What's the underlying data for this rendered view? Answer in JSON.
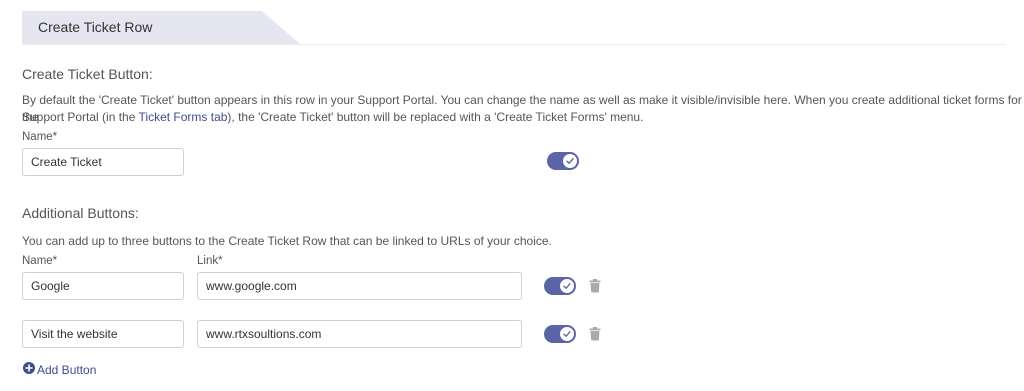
{
  "section": {
    "title": "Create Ticket Row"
  },
  "create_ticket": {
    "heading": "Create Ticket Button:",
    "desc_line1": "By default the 'Create Ticket' button appears in this row in your Support Portal. You can change the name as well as make it visible/invisible here. When you create additional ticket forms for the",
    "desc_line2_pre": "Support Portal (in the ",
    "desc_line2_link": "Ticket Forms tab",
    "desc_line2_post": "), the 'Create Ticket' button will be replaced with a 'Create Ticket Forms' menu.",
    "name_label": "Name*",
    "name_value": "Create Ticket",
    "visible": true
  },
  "additional": {
    "heading": "Additional Buttons:",
    "desc": "You can add up to three buttons to the Create Ticket Row that can be linked to URLs of your choice.",
    "name_label": "Name*",
    "link_label": "Link*",
    "buttons": [
      {
        "name": "Google",
        "link": "www.google.com",
        "visible": true
      },
      {
        "name": "Visit the website",
        "link": "www.rtxsoultions.com",
        "visible": true
      }
    ],
    "add_label": "Add Button"
  },
  "colors": {
    "accent": "#5c64a8",
    "link": "#3d4d8f",
    "tab_bg": "#e6e6f0"
  }
}
